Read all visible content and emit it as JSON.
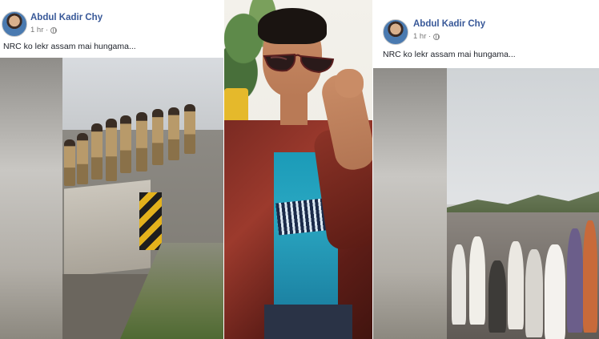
{
  "panels": {
    "left": {
      "author": "Abdul Kadir Chy",
      "time": "1 hr ·",
      "post_text": "NRC ko lekr assam mai hungama..."
    },
    "right": {
      "author": "Abdul Kadir Chy",
      "time": "1 hr ·",
      "post_text": "NRC ko lekr assam mai hungama..."
    }
  },
  "colors": {
    "author_link": "#385898",
    "meta_text": "#777777",
    "post_text": "#1d2129"
  },
  "icons": {
    "privacy": "globe-icon",
    "profile": "avatar"
  }
}
